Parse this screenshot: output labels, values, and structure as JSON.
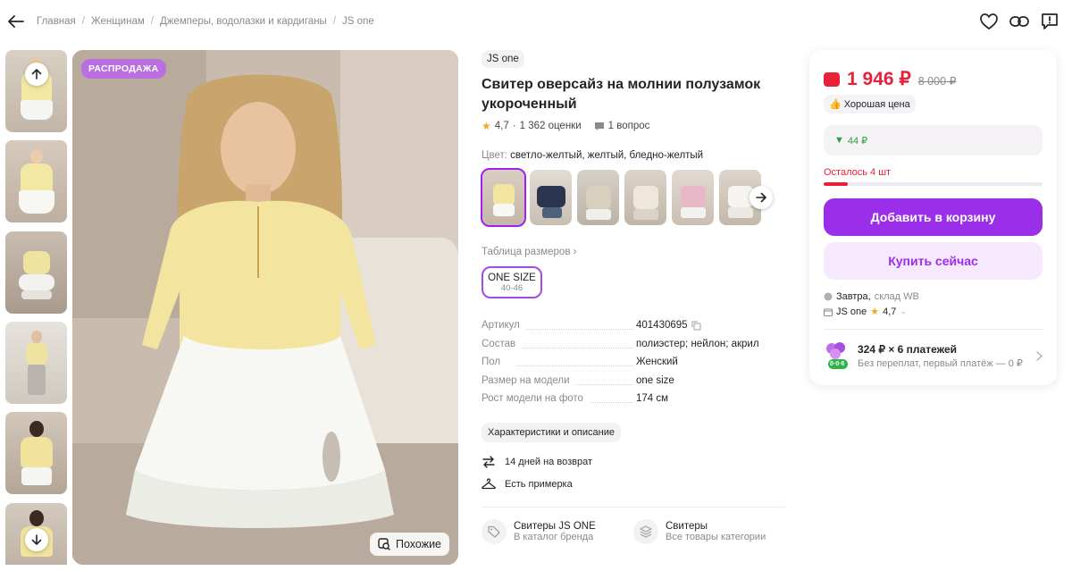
{
  "breadcrumbs": [
    "Главная",
    "Женщинам",
    "Джемперы, водолазки и кардиганы",
    "JS one"
  ],
  "top_actions": [
    "heart-icon",
    "link-icon",
    "report-icon"
  ],
  "gallery": {
    "badge": "РАСПРОДАЖА",
    "similar_label": "Похожие",
    "thumbnails_count": 6,
    "active_thumbnail": 2
  },
  "product": {
    "brand": "JS one",
    "title": "Свитер оверсайз на молнии полузамок укороченный",
    "rating": "4,7",
    "reviews": "1 362 оценки",
    "questions": "1 вопрос",
    "color_label": "Цвет:",
    "color_value": "светло-желтый, желтый, бледно-желтый",
    "size_table_label": "Таблица размеров",
    "size": {
      "name": "ONE SIZE",
      "range": "40-46"
    },
    "specs": [
      {
        "key": "Артикул",
        "value": "401430695"
      },
      {
        "key": "Состав",
        "value": "полиэстер; нейлон; акрил"
      },
      {
        "key": "Пол",
        "value": "Женский"
      },
      {
        "key": "Размер на модели",
        "value": "one size"
      },
      {
        "key": "Рост модели на фото",
        "value": "174 см"
      }
    ],
    "description_button": "Характеристики и описание",
    "features": [
      {
        "icon": "return-icon",
        "text": "14 дней на возврат"
      },
      {
        "icon": "hanger-icon",
        "text": "Есть примерка"
      }
    ],
    "links": [
      {
        "title": "Свитеры JS ONE",
        "subtitle": "В каталог бренда"
      },
      {
        "title": "Свитеры",
        "subtitle": "Все товары категории"
      }
    ]
  },
  "buy": {
    "price": "1 946 ₽",
    "old_price": "8 000 ₽",
    "good_price": "Хорошая цена",
    "cashback": "44 ₽",
    "stock_left": "Осталось 4 шт",
    "stock_fraction": 0.11,
    "add_to_cart": "Добавить в корзину",
    "buy_now": "Купить сейчас",
    "delivery_day": "Завтра,",
    "delivery_place": "склад WB",
    "seller": "JS one",
    "seller_rating": "4,7",
    "installment_title": "324 ₽ × 6 платежей",
    "installment_subtitle": "Без переплат, первый платёж — 0 ₽",
    "installment_badge": "0·0·6"
  },
  "colors": {
    "accent": "#9b2ee8",
    "price": "#e8203a",
    "cashback": "#2e9e46",
    "badge": "#b96fe0"
  }
}
